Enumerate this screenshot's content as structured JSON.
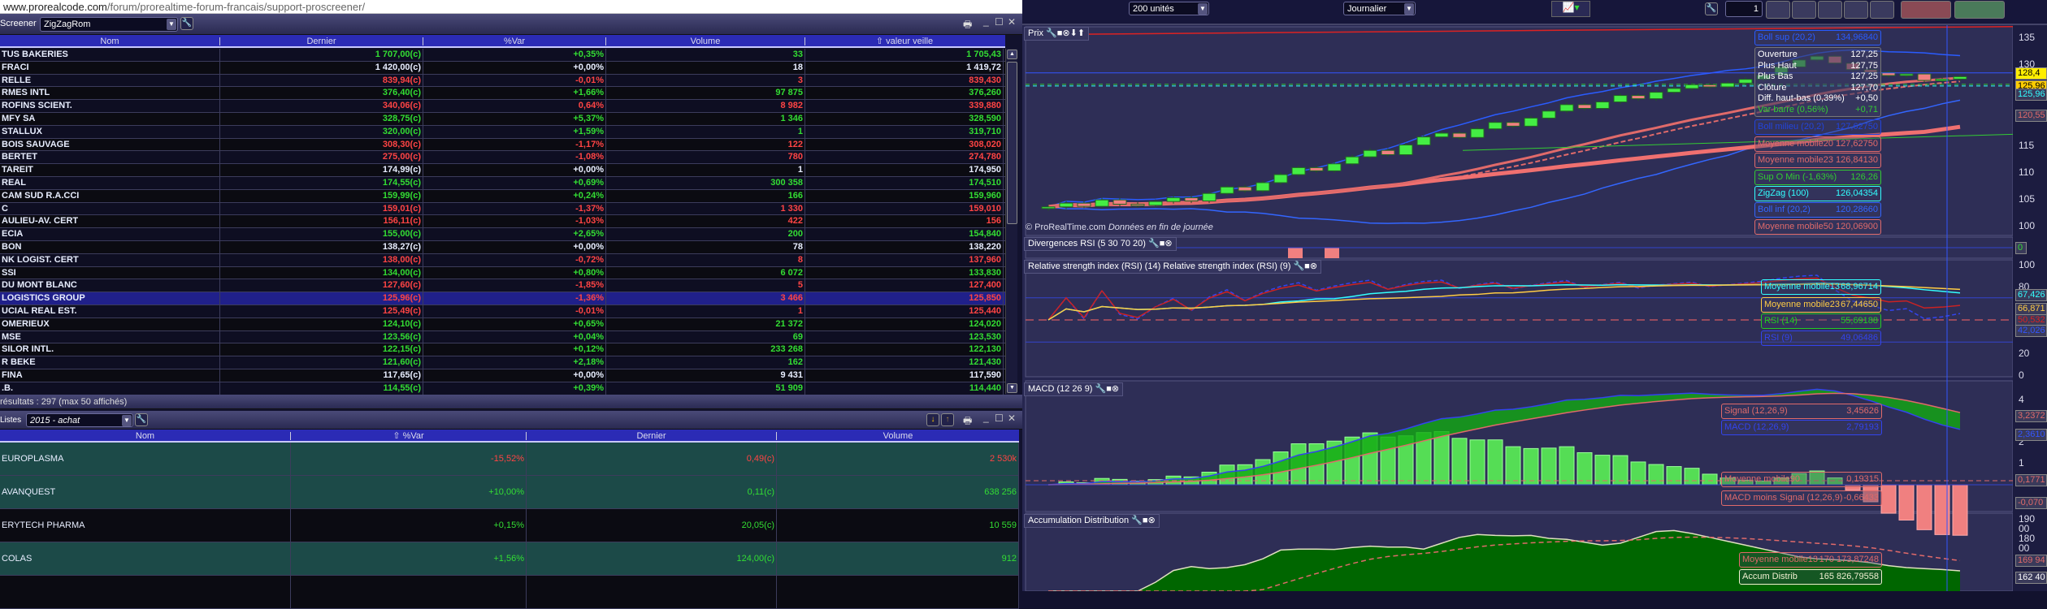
{
  "browser": {
    "url_domain": "www.prorealcode.com",
    "url_path": "/forum/prorealtime-forum-francais/support-proscreener/"
  },
  "screener": {
    "label": "Screener",
    "selected": "ZigZagRom",
    "columns": [
      "Nom",
      "Dernier",
      "%Var",
      "Volume",
      "valeur veille"
    ],
    "sort_icon": "arrow-up-icon",
    "rows": [
      {
        "nom": "TUS BAKERIES",
        "dernier": "1 707,00(c)",
        "var": "+0,35%",
        "volume": "33",
        "veille": "1 705,43",
        "trend": "up"
      },
      {
        "nom": "FRACI",
        "dernier": "1 420,00(c)",
        "var": "+0,00%",
        "volume": "18",
        "veille": "1 419,72",
        "trend": "flat"
      },
      {
        "nom": "RELLE",
        "dernier": "839,94(c)",
        "var": "-0,01%",
        "volume": "3",
        "veille": "839,430",
        "trend": "down"
      },
      {
        "nom": "RMES INTL",
        "dernier": "376,40(c)",
        "var": "+1,66%",
        "volume": "97 875",
        "veille": "376,260",
        "trend": "up"
      },
      {
        "nom": "ROFINS SCIENT.",
        "dernier": "340,06(c)",
        "var": "0,64%",
        "volume": "8 982",
        "veille": "339,880",
        "trend": "down"
      },
      {
        "nom": "MFY SA",
        "dernier": "328,75(c)",
        "var": "+5,37%",
        "volume": "1 346",
        "veille": "328,590",
        "trend": "up"
      },
      {
        "nom": "STALLUX",
        "dernier": "320,00(c)",
        "var": "+1,59%",
        "volume": "1",
        "veille": "319,710",
        "trend": "up"
      },
      {
        "nom": "BOIS SAUVAGE",
        "dernier": "308,30(c)",
        "var": "-1,17%",
        "volume": "122",
        "veille": "308,020",
        "trend": "down"
      },
      {
        "nom": "BERTET",
        "dernier": "275,00(c)",
        "var": "-1,08%",
        "volume": "780",
        "veille": "274,780",
        "trend": "down"
      },
      {
        "nom": "TAREIT",
        "dernier": "174,99(c)",
        "var": "+0,00%",
        "volume": "1",
        "veille": "174,950",
        "trend": "flat"
      },
      {
        "nom": "REAL",
        "dernier": "174,55(c)",
        "var": "+0,69%",
        "volume": "300 358",
        "veille": "174,510",
        "trend": "up"
      },
      {
        "nom": "CAM SUD R.A.CCI",
        "dernier": "159,99(c)",
        "var": "+0,24%",
        "volume": "166",
        "veille": "159,960",
        "trend": "up"
      },
      {
        "nom": "C",
        "dernier": "159,01(c)",
        "var": "-1,37%",
        "volume": "1 330",
        "veille": "159,010",
        "trend": "down"
      },
      {
        "nom": "AULIEU-AV. CERT",
        "dernier": "156,11(c)",
        "var": "-1,03%",
        "volume": "422",
        "veille": "156",
        "trend": "down"
      },
      {
        "nom": "ECIA",
        "dernier": "155,00(c)",
        "var": "+2,65%",
        "volume": "200",
        "veille": "154,840",
        "trend": "up"
      },
      {
        "nom": "BON",
        "dernier": "138,27(c)",
        "var": "+0,00%",
        "volume": "78",
        "veille": "138,220",
        "trend": "flat"
      },
      {
        "nom": "NK LOGIST. CERT",
        "dernier": "138,00(c)",
        "var": "-0,72%",
        "volume": "8",
        "veille": "137,960",
        "trend": "down"
      },
      {
        "nom": "SSI",
        "dernier": "134,00(c)",
        "var": "+0,80%",
        "volume": "6 072",
        "veille": "133,830",
        "trend": "up"
      },
      {
        "nom": "DU MONT BLANC",
        "dernier": "127,60(c)",
        "var": "-1,85%",
        "volume": "5",
        "veille": "127,400",
        "trend": "down"
      },
      {
        "nom": "LOGISTICS GROUP",
        "dernier": "125,96(c)",
        "var": "-1,36%",
        "volume": "3 466",
        "veille": "125,850",
        "trend": "down",
        "selected": true
      },
      {
        "nom": "UCIAL REAL EST.",
        "dernier": "125,49(c)",
        "var": "-0,01%",
        "volume": "1",
        "veille": "125,440",
        "trend": "down"
      },
      {
        "nom": "OMERIEUX",
        "dernier": "124,10(c)",
        "var": "+0,65%",
        "volume": "21 372",
        "veille": "124,020",
        "trend": "up"
      },
      {
        "nom": "MSE",
        "dernier": "123,56(c)",
        "var": "+0,04%",
        "volume": "69",
        "veille": "123,530",
        "trend": "up"
      },
      {
        "nom": "SILOR INTL.",
        "dernier": "122,15(c)",
        "var": "+0,12%",
        "volume": "233 268",
        "veille": "122,130",
        "trend": "up"
      },
      {
        "nom": "R BEKE",
        "dernier": "121,60(c)",
        "var": "+2,18%",
        "volume": "162",
        "veille": "121,430",
        "trend": "up"
      },
      {
        "nom": "FINA",
        "dernier": "117,65(c)",
        "var": "+0,00%",
        "volume": "9 431",
        "veille": "117,590",
        "trend": "flat"
      },
      {
        "nom": ".B.",
        "dernier": "114,55(c)",
        "var": "+0,39%",
        "volume": "51 909",
        "veille": "114,440",
        "trend": "up"
      }
    ],
    "footer": "résultats : 297 (max 50 affichés)"
  },
  "lists": {
    "label": "Listes",
    "selected": "2015 - achat",
    "columns": [
      "Nom",
      "%Var",
      "Dernier",
      "Volume"
    ],
    "rows": [
      {
        "nom": "EUROPLASMA",
        "var": "-15,52%",
        "dernier": "0,49(c)",
        "volume": "2 530k",
        "trend": "down",
        "bg": "teal"
      },
      {
        "nom": "AVANQUEST",
        "var": "+10,00%",
        "dernier": "0,11(c)",
        "volume": "638 256",
        "trend": "up",
        "bg": "teal"
      },
      {
        "nom": "ERYTECH PHARMA",
        "var": "+0,15%",
        "dernier": "20,05(c)",
        "volume": "10 559",
        "trend": "up",
        "bg": "black"
      },
      {
        "nom": "COLAS",
        "var": "+1,56%",
        "dernier": "124,00(c)",
        "volume": "912",
        "trend": "up",
        "bg": "teal"
      }
    ]
  },
  "toolbar": {
    "units": "200 unités",
    "period": "Journalier",
    "count": "1"
  },
  "price_panel": {
    "title": "Prix",
    "watermark_brand": "© ProRealTime.com",
    "watermark_note": "Données en fin de journée",
    "info": [
      {
        "label": "Ouverture",
        "value": "127,25"
      },
      {
        "label": "Plus Haut",
        "value": "127,75"
      },
      {
        "label": "Plus Bas",
        "value": "127,25"
      },
      {
        "label": "Clôture",
        "value": "127,70"
      },
      {
        "label": "Diff. haut-bas (0,39%)",
        "value": "+0,50"
      },
      {
        "label": "Var barre (0,56%)",
        "value": "+0,71",
        "color": "#33cc33"
      }
    ],
    "boll_sup": {
      "label": "Boll sup (20,2)",
      "value": "134,96840",
      "color": "#2a5cff"
    },
    "legends": [
      {
        "label": "Boll milieu (20,2)",
        "value": "127,62750",
        "color": "#2244dd"
      },
      {
        "label": "Moyenne mobile20",
        "value": "127,62750",
        "color": "#e06a6a"
      },
      {
        "label": "Moyenne mobile23",
        "value": "126,84130",
        "color": "#e06a6a"
      },
      {
        "label": "Sup O Min (-1,63%)",
        "value": "126,26",
        "color": "#33cc33"
      },
      {
        "label": "ZigZag (100)",
        "value": "126,04354",
        "color": "#33ffff"
      },
      {
        "label": "Boll inf (20,2)",
        "value": "120,28660",
        "color": "#3366ff"
      },
      {
        "label": "Moyenne mobile50",
        "value": "120,06900",
        "color": "#e06a6a"
      }
    ],
    "ticks": [
      "135",
      "130",
      "125",
      "120",
      "115",
      "110",
      "105",
      "100"
    ],
    "tags": [
      {
        "text": "128,4",
        "bg": "#ffee00",
        "fg": "#000"
      },
      {
        "text": "125,96",
        "bg": "#ffcc00",
        "fg": "#000"
      },
      {
        "text": "125,96",
        "bg": "#3a3a5a",
        "fg": "#33ffff"
      },
      {
        "text": "120,55",
        "bg": "#3a3a5a",
        "fg": "#e06a6a"
      }
    ]
  },
  "divergence_panel": {
    "title": "Divergences RSI (5 30 70 20)",
    "tag": "0"
  },
  "rsi_panel": {
    "title": "Relative strength index (RSI) (14) Relative strength index (RSI) (9)",
    "legends": [
      {
        "label": "Moyenne mobile13",
        "value": "68,96714",
        "color": "#33ffff"
      },
      {
        "label": "Moyenne mobile23",
        "value": "67,44650",
        "color": "#ffcc44"
      },
      {
        "label": "RSI (14)",
        "value": "55,69188",
        "color": "#22cc22"
      },
      {
        "label": "RSI (9)",
        "value": "49,06486",
        "color": "#3344ee"
      }
    ],
    "ticks": [
      "100",
      "80",
      "20",
      "0"
    ],
    "tags": [
      {
        "text": "67,426",
        "fg": "#33ffff"
      },
      {
        "text": "66,871",
        "fg": "#ffcc44"
      },
      {
        "text": "50,532",
        "fg": "#dd2222"
      },
      {
        "text": "42,026",
        "fg": "#3355ff"
      }
    ]
  },
  "macd_panel": {
    "title": "MACD (12 26 9)",
    "legends": [
      {
        "label": "Signal (12,26,9)",
        "value": "3,45626",
        "color": "#e06a6a"
      },
      {
        "label": "MACD (12,26,9)",
        "value": "2,79193",
        "color": "#3344ee"
      },
      {
        "label": "Moyenne mobile90",
        "value": "0,19315",
        "color": "#e06a6a"
      },
      {
        "label": "MACD moins Signal (12,26,9)",
        "value": "-0,66433",
        "color": "#e06a6a"
      }
    ],
    "ticks": [
      "4",
      "2",
      "1"
    ],
    "tags": [
      {
        "text": "3,2372",
        "fg": "#e06a6a"
      },
      {
        "text": "2,3610",
        "fg": "#3355ff"
      },
      {
        "text": "0,1771",
        "fg": "#e06a6a"
      },
      {
        "text": "-0,070",
        "fg": "#e06a6a"
      }
    ]
  },
  "accum_panel": {
    "title": "Accumulation Distribution",
    "legends": [
      {
        "label": "Moyenne mobile13",
        "value": "170 173,87248",
        "color": "#e06a6a"
      },
      {
        "label": "Accum Distrib",
        "value": "165 826,79558",
        "color": "#f0f0d0"
      }
    ],
    "ticks": [
      "190 00",
      "180 00"
    ],
    "tags": [
      {
        "text": "169 94",
        "fg": "#e06a6a"
      },
      {
        "text": "162 40",
        "fg": "#fff"
      }
    ]
  },
  "colors": {
    "up": "#33dd33",
    "down": "#ff4444",
    "flat": "#e8eeff",
    "header": "#2b2bb5",
    "selected_row": "#20208a",
    "teal_row": "#1c4a48",
    "candle_up": "#44ee44",
    "candle_down": "#f08080"
  },
  "chart_data": {
    "type": "candlestick",
    "price_closes": [
      103.5,
      104.2,
      103.6,
      104.8,
      104.0,
      103.8,
      104.5,
      105.2,
      104.6,
      106.0,
      107.2,
      106.5,
      108.0,
      109.5,
      110.8,
      110.2,
      111.5,
      112.8,
      114.0,
      113.2,
      115.0,
      116.5,
      117.2,
      116.4,
      118.0,
      119.2,
      118.5,
      120.0,
      121.3,
      122.5,
      121.8,
      123.0,
      124.2,
      123.6,
      124.8,
      125.5,
      126.2,
      125.8,
      126.5,
      127.2,
      128.0,
      129.5,
      130.8,
      131.5,
      130.2,
      129.0,
      128.5,
      127.9,
      128.2,
      127.0,
      127.25,
      127.7
    ],
    "price_ylim": [
      100,
      135
    ],
    "rsi_ylim": [
      0,
      100
    ],
    "accum_values": [
      140000,
      141000,
      142000,
      143000,
      145000,
      150000,
      160000,
      166000,
      168000,
      167000,
      167500,
      169000,
      172000,
      176500,
      177000,
      177000,
      176800,
      177800,
      178500,
      178000,
      178000,
      177000,
      180000,
      183000,
      184500,
      184000,
      183800,
      184000,
      182500,
      182000,
      180500,
      179000,
      180000,
      183000,
      186000,
      186500,
      185000,
      183000,
      181000,
      179000,
      177000,
      175000,
      173000,
      172000,
      171500,
      171000,
      170000,
      168500,
      167500,
      167000,
      166500,
      165826.8
    ]
  }
}
